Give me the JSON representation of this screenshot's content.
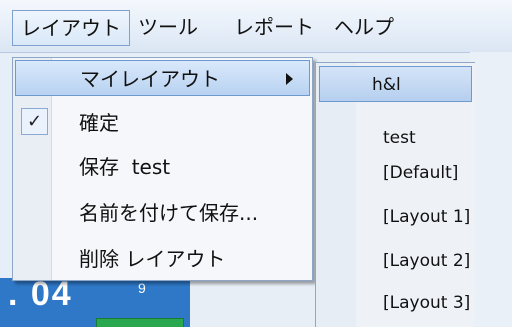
{
  "menubar": {
    "items": [
      "レイアウト",
      "ツール",
      "レポート",
      "ヘルプ"
    ]
  },
  "background": {
    "digits": ". 04",
    "superscript": "9"
  },
  "dropdown": {
    "items": [
      {
        "label": "マイレイアウト",
        "has_submenu": true
      },
      {
        "label": "確定",
        "checked": true,
        "check_glyph": "✓"
      },
      {
        "label": "保存  test"
      },
      {
        "label": "名前を付けて保存..."
      },
      {
        "label": "削除 レイアウト"
      }
    ]
  },
  "submenu": {
    "items": [
      "h&l",
      "test",
      "[Default]",
      "[Layout 1]",
      "[Layout 2]",
      "[Layout 3]"
    ]
  }
}
